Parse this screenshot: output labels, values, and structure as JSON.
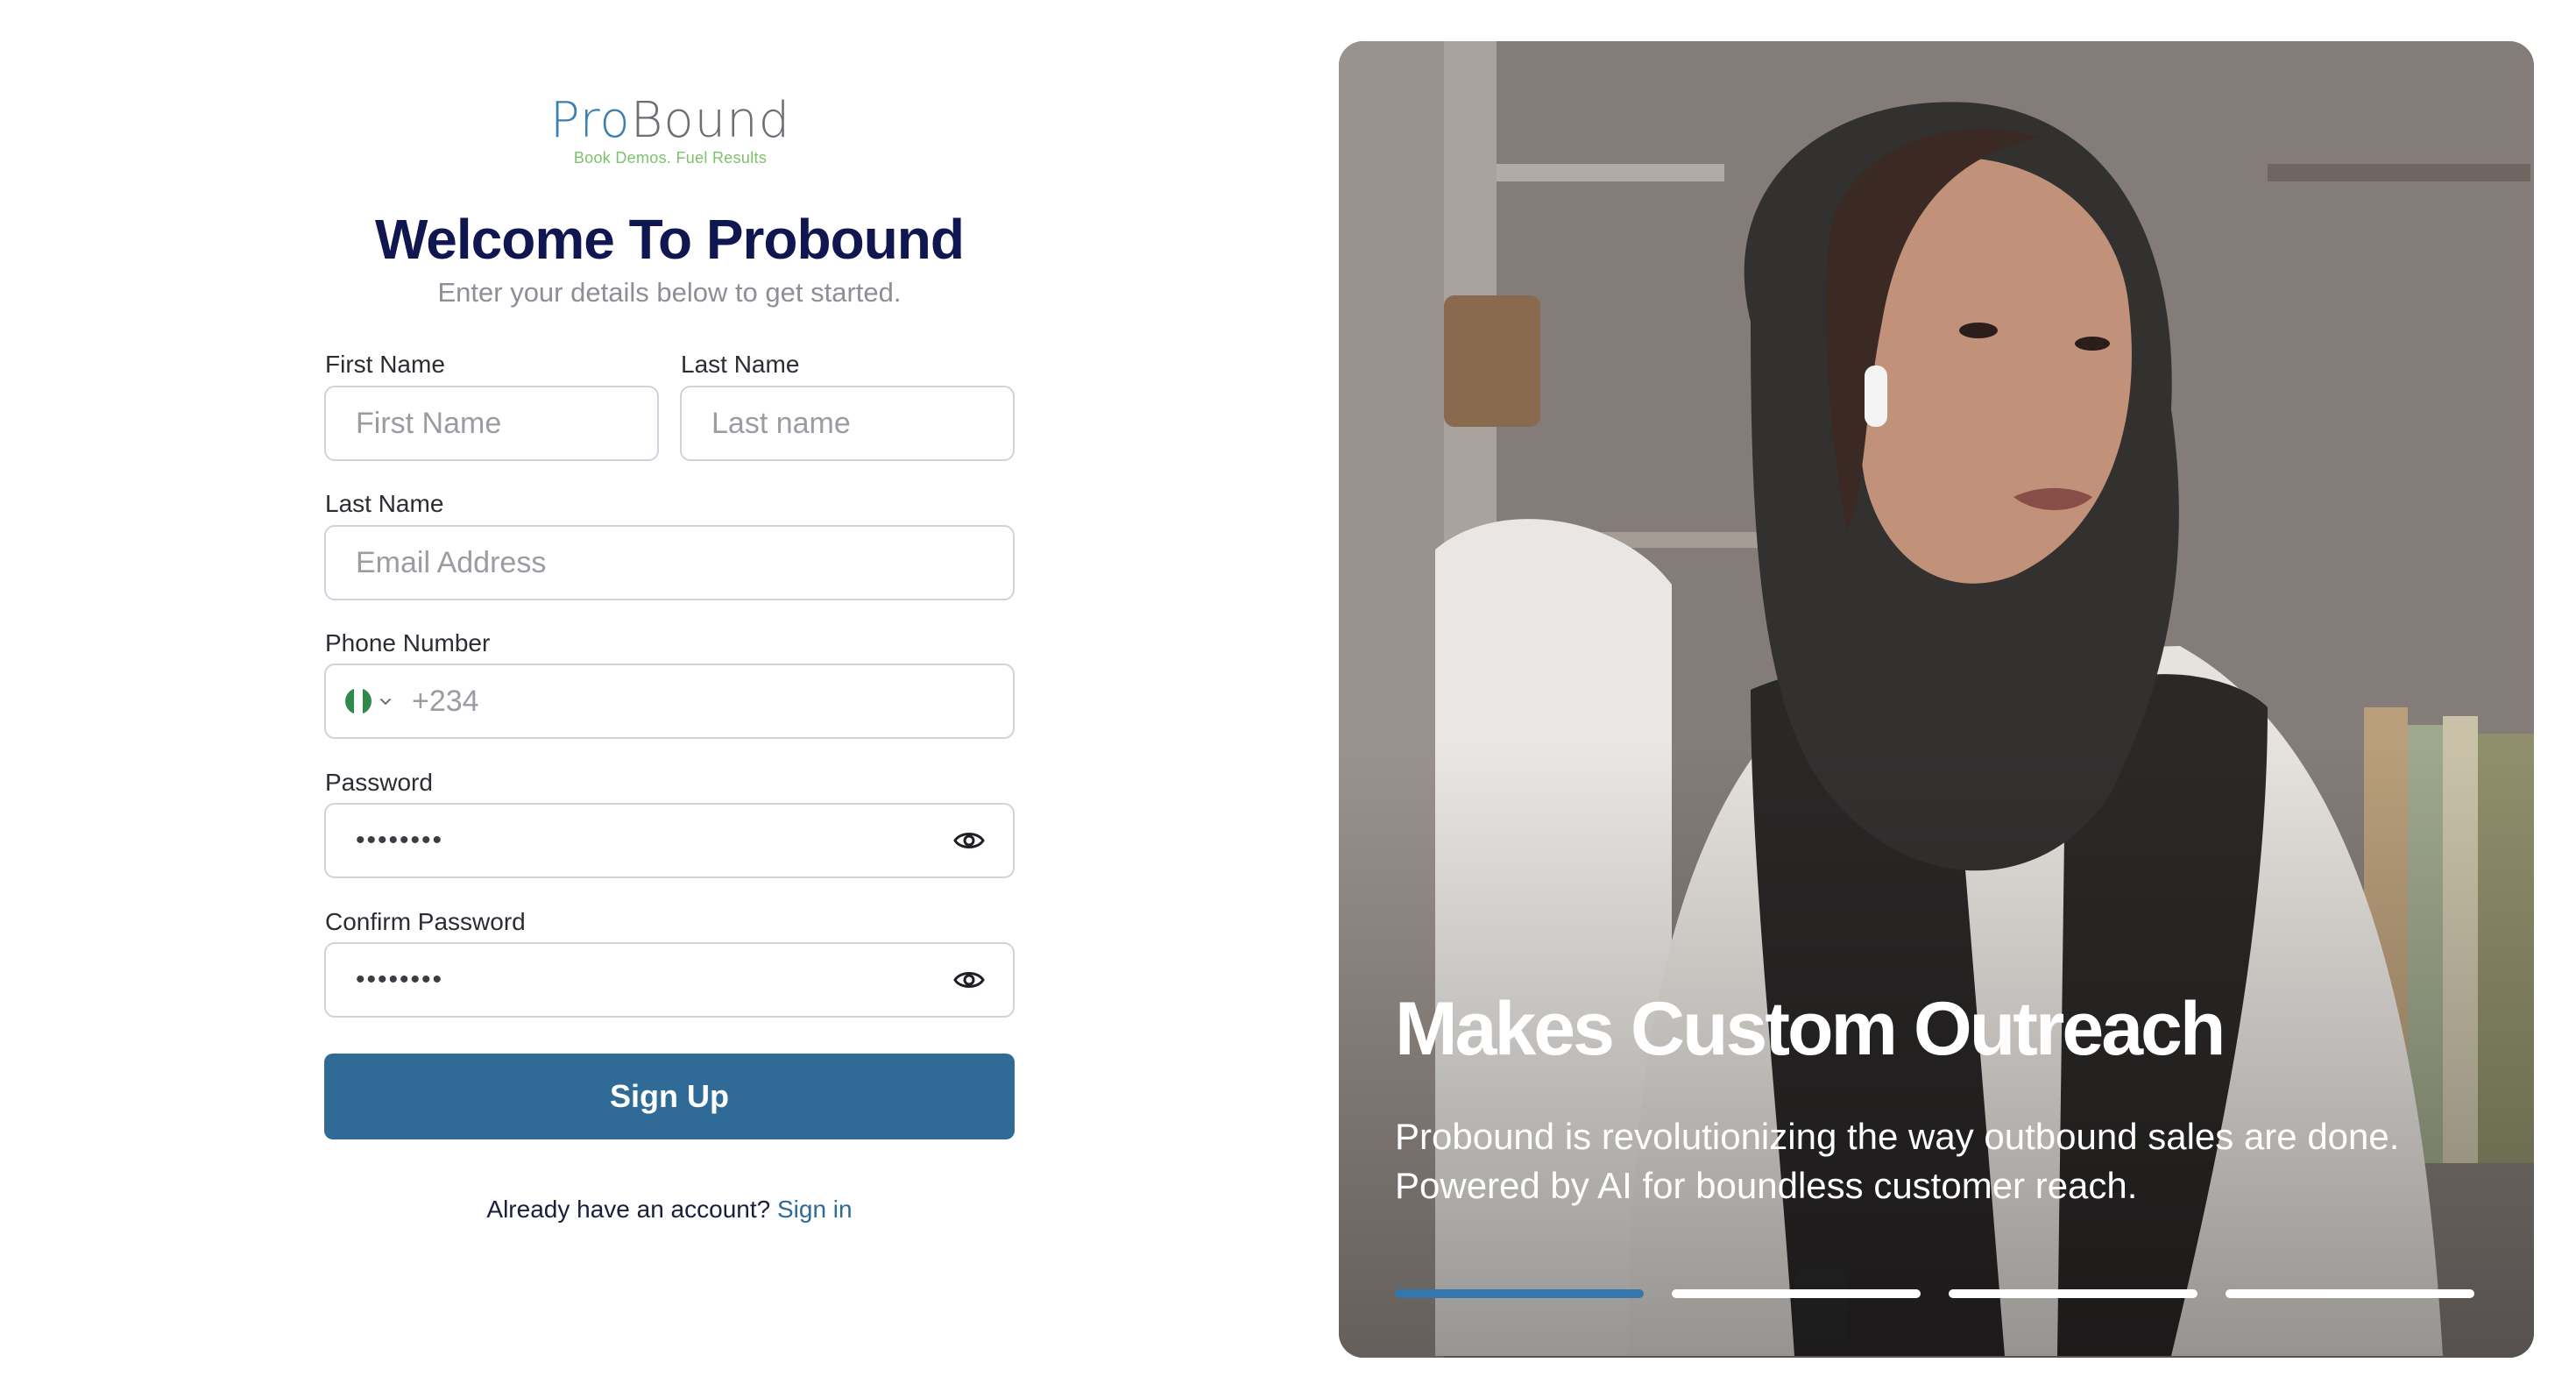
{
  "brand": {
    "name_part1": "Pro",
    "name_part2": "Bound",
    "tagline": "Book Demos. Fuel Results"
  },
  "form": {
    "title": "Welcome To Probound",
    "subtitle": "Enter your details below to get started.",
    "first_name": {
      "label": "First Name",
      "placeholder": "First Name"
    },
    "last_name": {
      "label": "Last Name",
      "placeholder": "Last name"
    },
    "email": {
      "label": "Last Name",
      "placeholder": "Email Address"
    },
    "phone": {
      "label": "Phone Number",
      "placeholder": "+234",
      "country_flag": "nigeria-flag"
    },
    "password": {
      "label": "Password",
      "value": "••••••••"
    },
    "confirm_password": {
      "label": "Confirm Password",
      "value": "••••••••"
    },
    "submit_label": "Sign Up",
    "signin_prompt": "Already have an account?",
    "signin_link": "Sign in"
  },
  "hero": {
    "title": "Makes Custom Outreach",
    "text": "Probound is revolutionizing the way outbound sales are done. Powered by AI for boundless customer reach.",
    "slides_total": 4,
    "active_slide": 1
  },
  "colors": {
    "primary": "#2f6b96",
    "title": "#0f1650",
    "active_indicator": "#3576ad",
    "logo_green": "#7cc16b"
  },
  "icons": [
    "eye-icon",
    "chevron-down-icon",
    "nigeria-flag-icon"
  ]
}
